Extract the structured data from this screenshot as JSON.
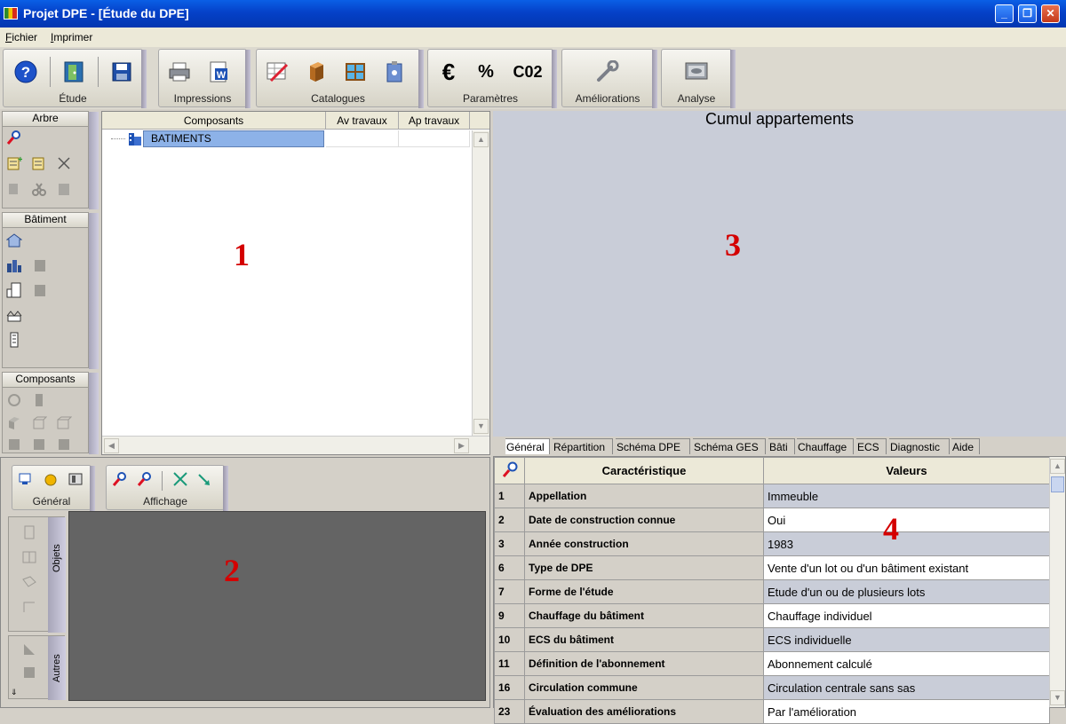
{
  "window": {
    "title": "Projet DPE - [Étude du DPE]"
  },
  "menu": {
    "items": [
      "Fichier",
      "Imprimer"
    ]
  },
  "toolbar": {
    "groups": [
      {
        "label": "Étude"
      },
      {
        "label": "Impressions"
      },
      {
        "label": "Catalogues"
      },
      {
        "label": "Paramètres",
        "icons": [
          "€",
          "%",
          "C02"
        ]
      },
      {
        "label": "Améliorations"
      },
      {
        "label": "Analyse"
      }
    ]
  },
  "left_tools": {
    "sections": [
      "Arbre",
      "Bâtiment",
      "Composants"
    ]
  },
  "tree": {
    "headers": [
      "Composants",
      "Av travaux",
      "Ap travaux"
    ],
    "root": "BATIMENTS"
  },
  "view3": {
    "title": "Cumul appartements"
  },
  "tabs": [
    "Général",
    "Répartition",
    "Schéma DPE",
    "Schéma GES",
    "Bâti",
    "Chauffage",
    "ECS",
    "Diagnostic",
    "Aide"
  ],
  "grid": {
    "headers": [
      "Caractéristique",
      "Valeurs"
    ],
    "rows": [
      {
        "num": "1",
        "car": "Appellation",
        "val": "Immeuble"
      },
      {
        "num": "2",
        "car": "Date de construction connue",
        "val": "Oui"
      },
      {
        "num": "3",
        "car": "Année construction",
        "val": "1983"
      },
      {
        "num": "6",
        "car": "Type de DPE",
        "val": "Vente d'un lot ou d'un bâtiment existant"
      },
      {
        "num": "7",
        "car": "Forme de l'étude",
        "val": "Etude d'un ou de plusieurs lots"
      },
      {
        "num": "9",
        "car": "Chauffage du bâtiment",
        "val": "Chauffage individuel"
      },
      {
        "num": "10",
        "car": "ECS du bâtiment",
        "val": "ECS individuelle"
      },
      {
        "num": "11",
        "car": "Définition de l'abonnement",
        "val": "Abonnement calculé"
      },
      {
        "num": "16",
        "car": "Circulation commune",
        "val": "Circulation centrale sans sas"
      },
      {
        "num": "23",
        "car": "Évaluation des améliorations",
        "val": "Par l'amélioration"
      }
    ]
  },
  "editor2d": {
    "groups": [
      {
        "label": "Général"
      },
      {
        "label": "Affichage"
      }
    ],
    "side_tabs": [
      "Objets",
      "Autres"
    ]
  },
  "markers": {
    "one": "1",
    "two": "2",
    "three": "3",
    "four": "4"
  },
  "colors": {
    "titlebar": "#0541c8",
    "marker": "#d40000",
    "selection": "#8db2e8"
  }
}
